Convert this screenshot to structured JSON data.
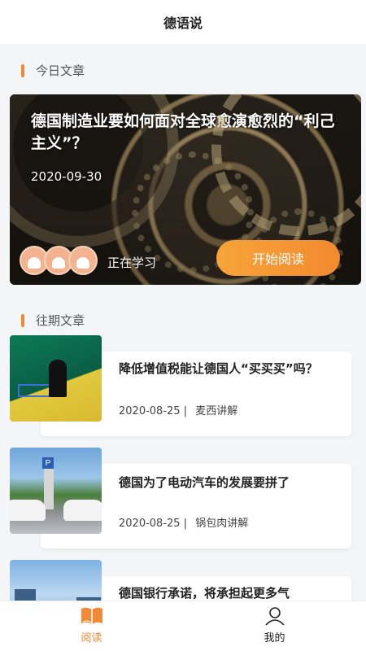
{
  "nav": {
    "title": "德语说"
  },
  "today": {
    "section_label": "今日文章",
    "title": "德国制造业要如何面对全球愈演愈烈的“利己主义”？",
    "date": "2020-09-30",
    "learning_label": "正在学习",
    "start_button": "开始阅读"
  },
  "past": {
    "section_label": "往期文章",
    "articles": [
      {
        "title": "降低增值税能让德国人“买买买”吗？",
        "date": "2020-08-25 |",
        "author": "麦西讲解"
      },
      {
        "title": "德国为了电动汽车的发展要拼了",
        "date": "2020-08-25 |",
        "author": "锅包肉讲解"
      },
      {
        "title": "德国银行承诺，将承担起更多气",
        "date": "",
        "author": ""
      }
    ]
  },
  "tabbar": {
    "read_label": "阅读",
    "mine_label": "我的"
  },
  "colors": {
    "accent": "#f08a35"
  },
  "icons": {
    "read": "open-book-icon",
    "mine": "person-icon"
  }
}
